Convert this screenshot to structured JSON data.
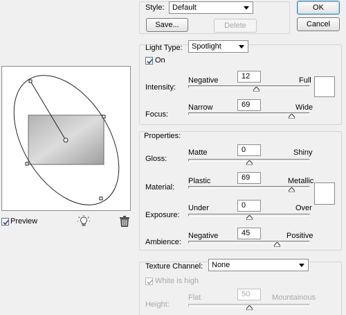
{
  "style": {
    "label": "Style:",
    "value": "Default",
    "save_label": "Save...",
    "delete_label": "Delete"
  },
  "actions": {
    "ok_label": "OK",
    "cancel_label": "Cancel"
  },
  "light": {
    "type_label": "Light Type:",
    "type_value": "Spotlight",
    "on_label": "On",
    "on_checked": true,
    "intensity": {
      "label": "Intensity:",
      "left": "Negative",
      "right": "Full",
      "value": "12",
      "level": 0.56
    },
    "focus": {
      "label": "Focus:",
      "left": "Narrow",
      "right": "Wide",
      "value": "69",
      "level": 0.85
    }
  },
  "properties": {
    "heading": "Properties:",
    "gloss": {
      "label": "Gloss:",
      "left": "Matte",
      "right": "Shiny",
      "value": "0",
      "level": 0.5
    },
    "material": {
      "label": "Material:",
      "left": "Plastic",
      "right": "Metallic",
      "value": "69",
      "level": 0.85
    },
    "exposure": {
      "label": "Exposure:",
      "left": "Under",
      "right": "Over",
      "value": "0",
      "level": 0.5
    },
    "ambience": {
      "label": "Ambience:",
      "left": "Negative",
      "right": "Positive",
      "value": "45",
      "level": 0.73
    }
  },
  "texture": {
    "label": "Texture Channel:",
    "value": "None",
    "white_high_label": "White is high",
    "white_high_checked": true,
    "height": {
      "label": "Height:",
      "left": "Flat",
      "right": "Mountainous",
      "value": "50",
      "level": 0.5
    }
  },
  "preview": {
    "label": "Preview",
    "checked": true,
    "light_icon": "light-bulb-icon",
    "trash_icon": "trash-icon"
  },
  "colors": {
    "accent": "#3c7fb1",
    "check": "#2a4a78"
  }
}
